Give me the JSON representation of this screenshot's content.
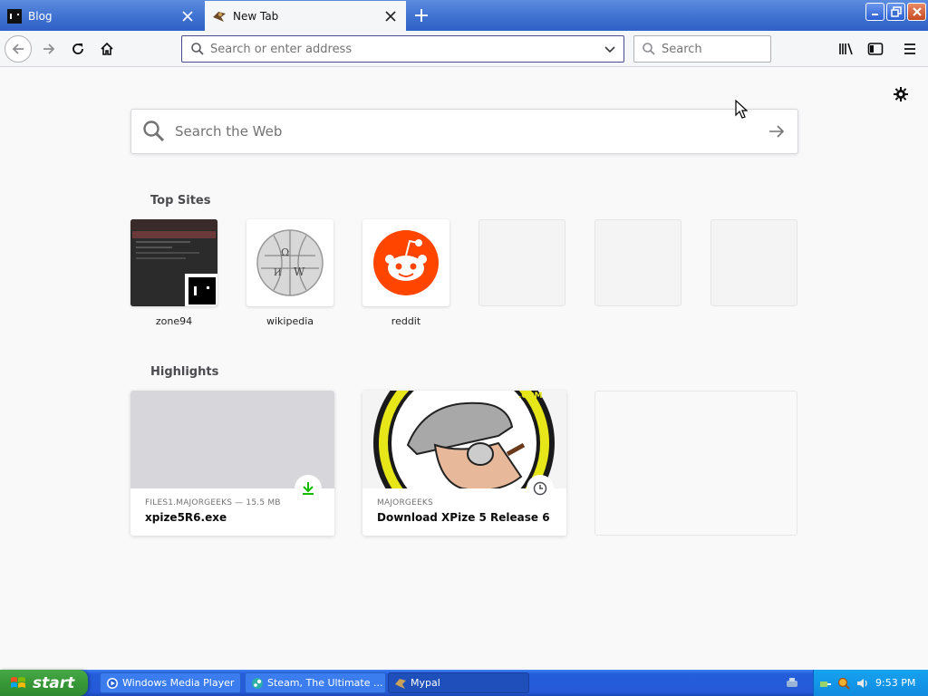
{
  "tabs": [
    {
      "title": "Blog"
    },
    {
      "title": "New Tab"
    }
  ],
  "navbar": {
    "url_placeholder": "Search or enter address",
    "search_placeholder": "Search"
  },
  "content": {
    "web_search_placeholder": "Search the Web",
    "top_sites_title": "Top Sites",
    "top_sites": [
      {
        "label": "zone94"
      },
      {
        "label": "wikipedia"
      },
      {
        "label": "reddit"
      }
    ],
    "highlights_title": "Highlights",
    "highlights": [
      {
        "meta": "FILES1.MAJORGEEKS — 15.5 MB",
        "name": "xpize5R6.exe"
      },
      {
        "meta": "MAJORGEEKS",
        "name": "Download XPize 5 Release 6"
      }
    ]
  },
  "taskbar": {
    "start_label": "start",
    "tasks": [
      {
        "label": "Windows Media Player"
      },
      {
        "label": "Steam, The Ultimate ..."
      },
      {
        "label": "Mypal"
      }
    ],
    "clock": "9:53 PM"
  },
  "colors": {
    "accent": "#0a84ff",
    "reddit": "#ff4500",
    "download_green": "#12bc00",
    "xp_taskbar": "#245edb",
    "xp_start": "#389838"
  }
}
